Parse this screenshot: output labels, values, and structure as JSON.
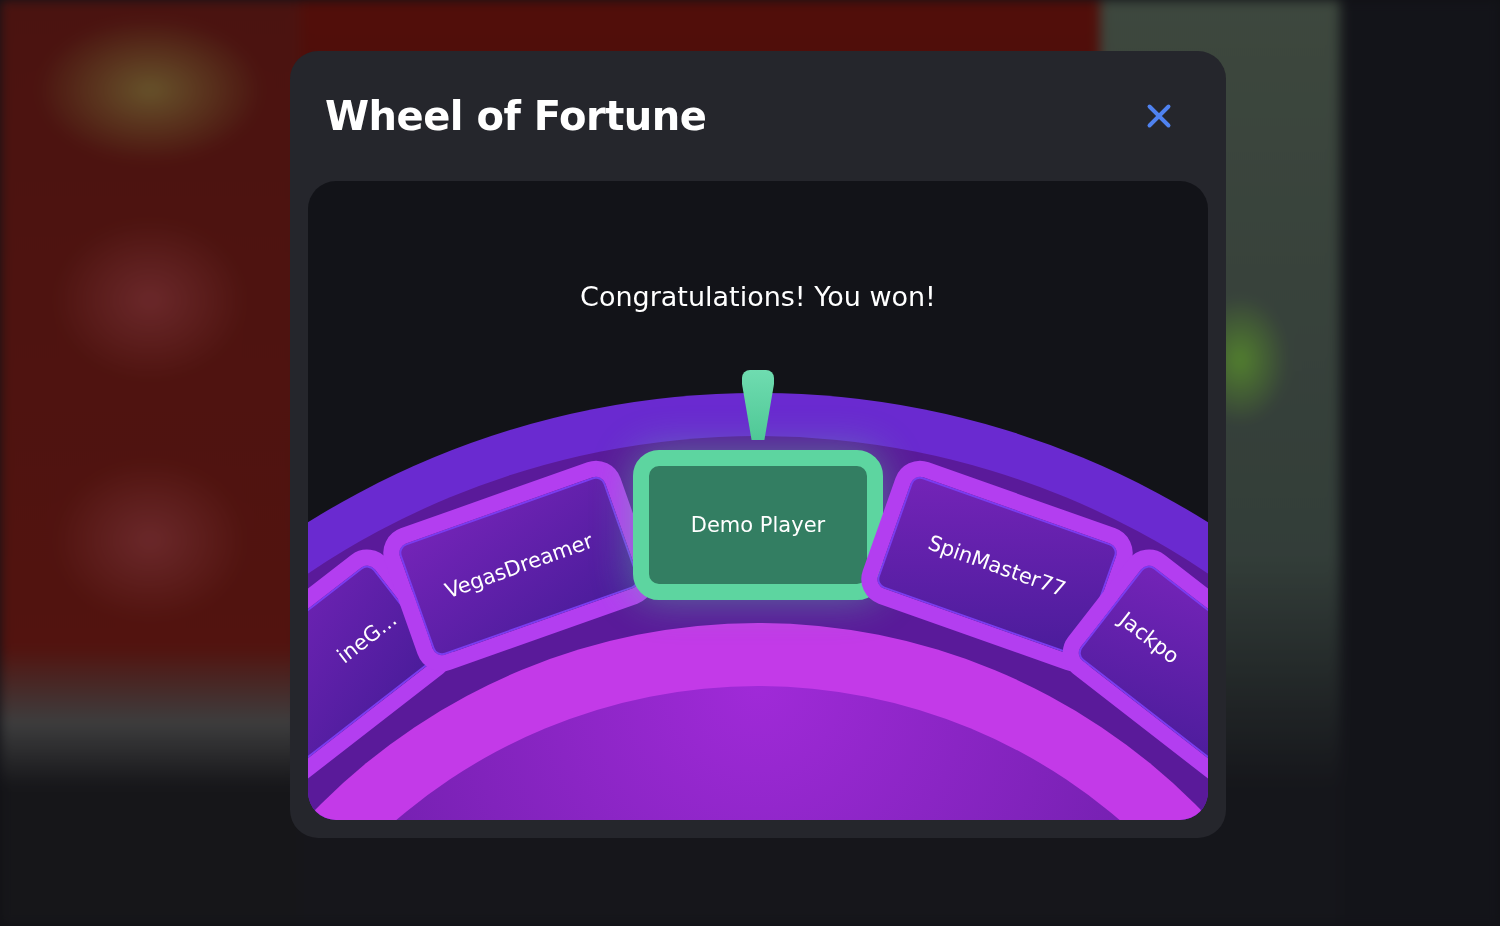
{
  "dialog": {
    "title": "Wheel of Fortune"
  },
  "wheel": {
    "message": "Congratulations! You won!",
    "segments": [
      {
        "label": "ineG...",
        "selected": false
      },
      {
        "label": "VegasDreamer",
        "selected": false
      },
      {
        "label": "Demo Player",
        "selected": true
      },
      {
        "label": "SpinMaster77",
        "selected": false
      },
      {
        "label": "Jackpo",
        "selected": false
      }
    ]
  }
}
